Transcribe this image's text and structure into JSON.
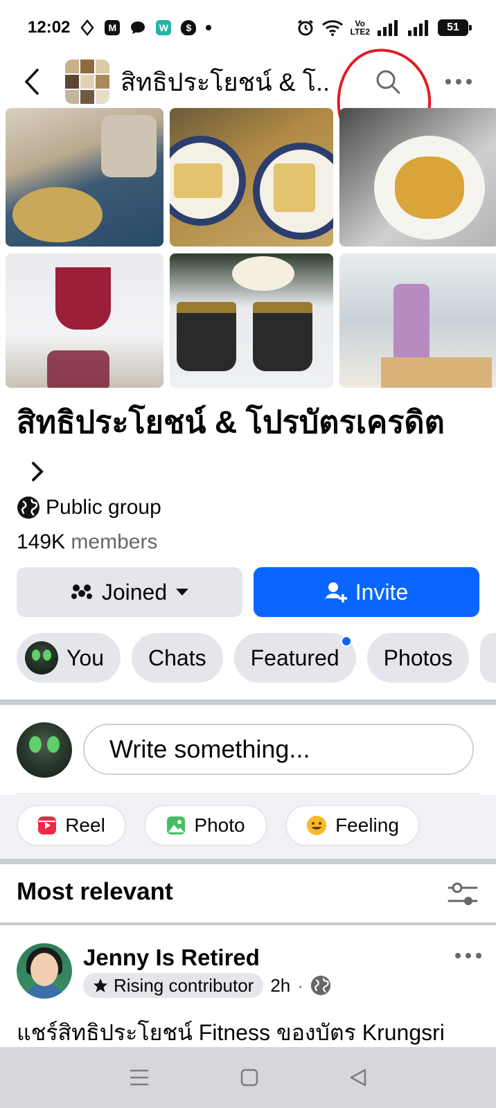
{
  "status_bar": {
    "time": "12:02",
    "left_icons": [
      "notification-icon",
      "m-app-icon",
      "chat-bubble-icon",
      "w-app-icon",
      "shield-dollar-icon",
      "more-dot-icon"
    ],
    "badge_m": "M",
    "badge_w": "W",
    "badge_dollar": "$",
    "volte_top": "Vo",
    "volte_bottom": "LTE2",
    "battery": "51"
  },
  "top_nav": {
    "title": "สิทธิประโยชน์ & โ..."
  },
  "group": {
    "name": "สิทธิประโยชน์ & โปรบัตรเครดิต",
    "privacy": "Public group",
    "member_count": "149K",
    "member_label": "members"
  },
  "actions": {
    "joined": "Joined",
    "invite": "Invite"
  },
  "tabs": [
    {
      "label": "You"
    },
    {
      "label": "Chats"
    },
    {
      "label": "Featured"
    },
    {
      "label": "Photos"
    }
  ],
  "composer": {
    "placeholder": "Write something...",
    "buttons": [
      {
        "label": "Reel"
      },
      {
        "label": "Photo"
      },
      {
        "label": "Feeling"
      }
    ]
  },
  "feed": {
    "sort_label": "Most relevant",
    "post": {
      "author": "Jenny Is Retired",
      "badge": "Rising contributor",
      "time": "2h",
      "separator": "·",
      "text": "แชร์สิทธิประโยชน์ Fitness ของบัตร Krungsri"
    }
  },
  "colors": {
    "accent_blue": "#0866ff",
    "chip_gray": "#e4e6eb",
    "annotation_red": "#e31b23"
  }
}
